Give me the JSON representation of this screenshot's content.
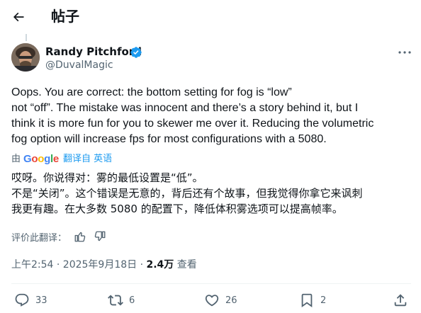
{
  "header": {
    "title": "帖子",
    "back_icon": "arrow-left-icon"
  },
  "author": {
    "name": "Randy Pitchford",
    "handle": "@DuvalMagic",
    "verified": true,
    "verified_color": "#1d9bf0"
  },
  "tweet": {
    "text_lines": [
      "Oops. You are correct: the bottom setting for fog is “low”",
      "not “off”. The mistake was innocent and there’s a story behind it, but I",
      "think it is more fun for you to skewer me over it. Reducing the volumetric",
      "fog option will increase fps for most configurations with a 5080."
    ]
  },
  "translation": {
    "by_label": "由",
    "provider": "Google",
    "provider_colors": [
      "#4285F4",
      "#EA4335",
      "#FBBC05",
      "#4285F4",
      "#34A853",
      "#EA4335"
    ],
    "link_label": "翻译自 英语",
    "lines": [
      "哎呀。你说得对：雾的最低设置是“低”。",
      "不是“关闭”。这个错误是无意的，背后还有个故事，但我觉得你拿它来讽刺",
      "我更有趣。在大多数 5080 的配置下，降低体积雾选项可以提高帧率。"
    ]
  },
  "rating": {
    "label": "评价此翻译："
  },
  "meta": {
    "time": "上午2:54 · 2025年9月18日 · ",
    "views_count": "2.4万",
    "views_label": " 查看"
  },
  "actions": {
    "replies": "33",
    "reposts": "6",
    "likes": "26",
    "bookmarks": "2"
  },
  "colors": {
    "text": "#0f1419",
    "secondary": "#536471",
    "link": "#1d9bf0"
  }
}
